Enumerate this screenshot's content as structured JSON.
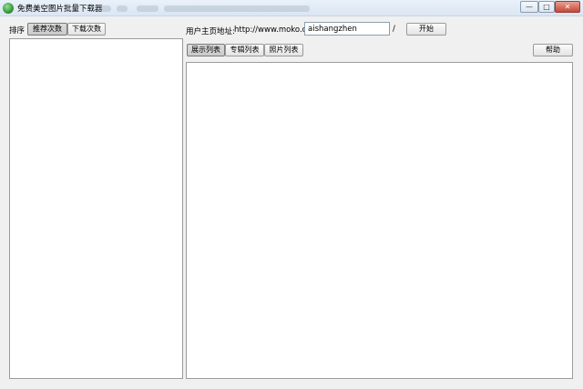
{
  "window": {
    "title": "免费美空图片批量下载器",
    "controls": {
      "minimize": "—",
      "maximize": "□",
      "close": "✕"
    }
  },
  "left": {
    "sort_label": "排序",
    "buttons": [
      "推荐次数",
      "下载次数"
    ]
  },
  "form": {
    "url_label": "用户主页地址:",
    "url_prefix": "http://www.moko.cc/",
    "username": "aishangzhen",
    "suffix": "/",
    "start_button": "开始"
  },
  "tabs": [
    "展示列表",
    "专辑列表",
    "照片列表"
  ],
  "help_button": "帮助"
}
